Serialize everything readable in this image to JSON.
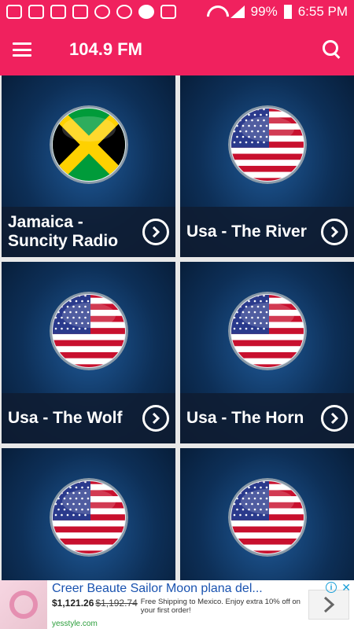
{
  "status_bar": {
    "battery_text": "99%",
    "time": "6:55 PM"
  },
  "app_bar": {
    "title": "104.9 FM"
  },
  "stations": [
    {
      "name": "Jamaica - Suncity Radio",
      "flag": "jamaica-flag"
    },
    {
      "name": "Usa - The River",
      "flag": "usa-flag"
    },
    {
      "name": "Usa - The Wolf",
      "flag": "usa-flag"
    },
    {
      "name": "Usa - The Horn",
      "flag": "usa-flag"
    },
    {
      "name": "",
      "flag": "usa-flag"
    },
    {
      "name": "",
      "flag": "usa-flag"
    }
  ],
  "ad": {
    "title": "Creer Beaute Sailor Moon plana del...",
    "price": "$1,121.26",
    "old_price": "$1,192.74",
    "description": "Free Shipping to Mexico. Enjoy extra 10% off on your first order!",
    "site": "yesstyle.com"
  },
  "colors": {
    "accent": "#f0215e",
    "card_bg": "#0d2f57"
  }
}
